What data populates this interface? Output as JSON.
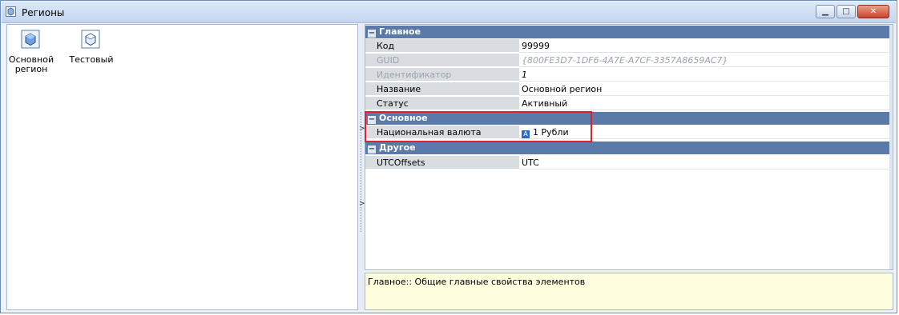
{
  "window": {
    "title": "Регионы"
  },
  "regions": [
    {
      "label": "Основной регион"
    },
    {
      "label": "Тестовый"
    }
  ],
  "grid": {
    "sections": [
      {
        "title": "Главное",
        "rows": [
          {
            "key": "Код",
            "value": "99999"
          },
          {
            "key": "GUID",
            "value": "{800FE3D7-1DF6-4A7E-A7CF-3357A8659AC7}"
          },
          {
            "key": "Идентификатор",
            "value": "1"
          },
          {
            "key": "Название",
            "value": "Основной регион"
          },
          {
            "key": "Статус",
            "value": "Активный"
          }
        ]
      },
      {
        "title": "Основное",
        "rows": [
          {
            "key": "Национальная валюта",
            "value": "1 Рубли"
          }
        ]
      },
      {
        "title": "Другое",
        "rows": [
          {
            "key": "UTCOffsets",
            "value": "UTC"
          }
        ]
      }
    ]
  },
  "description": "Главное:: Общие главные свойства элементов",
  "colors": {
    "section_header": "#5a7baa",
    "highlight": "#e0202a",
    "description_bg": "#ffffdf"
  },
  "icons": {
    "app": "region-icon",
    "region_item": "cube-icon",
    "currency_badge": "letter-a-icon"
  }
}
